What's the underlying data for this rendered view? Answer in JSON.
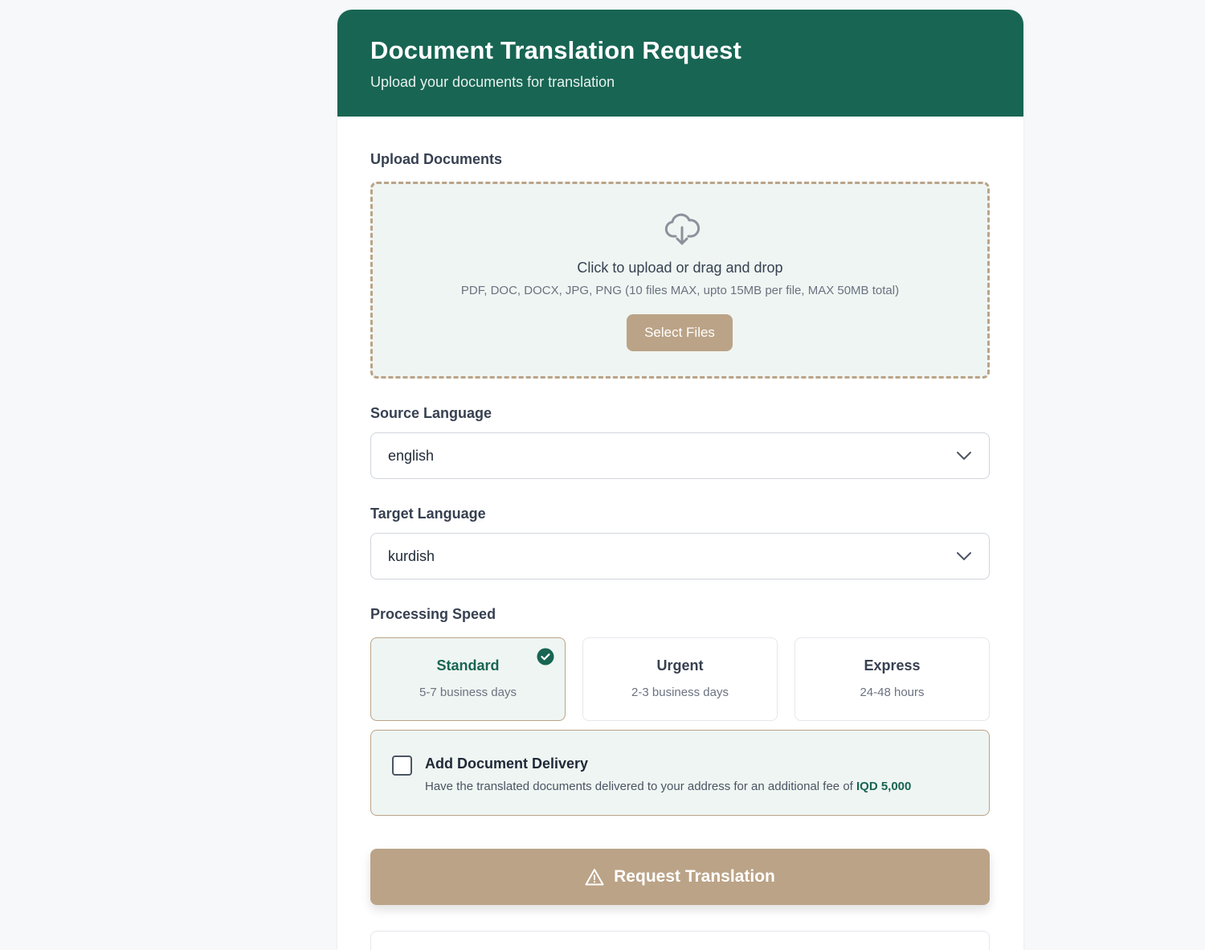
{
  "header": {
    "title": "Document Translation Request",
    "subtitle": "Upload your documents for translation"
  },
  "upload": {
    "label": "Upload Documents",
    "title": "Click to upload or drag and drop",
    "hint": "PDF, DOC, DOCX, JPG, PNG (10 files MAX, upto 15MB per file, MAX 50MB total)",
    "button": "Select Files",
    "icon": "cloud-download-icon"
  },
  "source_language": {
    "label": "Source Language",
    "value": "english"
  },
  "target_language": {
    "label": "Target Language",
    "value": "kurdish"
  },
  "processing_speed": {
    "label": "Processing Speed",
    "options": [
      {
        "title": "Standard",
        "subtitle": "5-7 business days",
        "selected": true
      },
      {
        "title": "Urgent",
        "subtitle": "2-3 business days",
        "selected": false
      },
      {
        "title": "Express",
        "subtitle": "24-48 hours",
        "selected": false
      }
    ]
  },
  "delivery": {
    "title": "Add Document Delivery",
    "description": "Have the translated documents delivered to your address for an additional fee of",
    "fee": "IQD 5,000",
    "checked": false
  },
  "submit": {
    "label": "Request Translation",
    "icon": "warning-triangle-icon"
  },
  "colors": {
    "primary": "#186553",
    "accent": "#bba387",
    "panel": "#eff5f2"
  }
}
